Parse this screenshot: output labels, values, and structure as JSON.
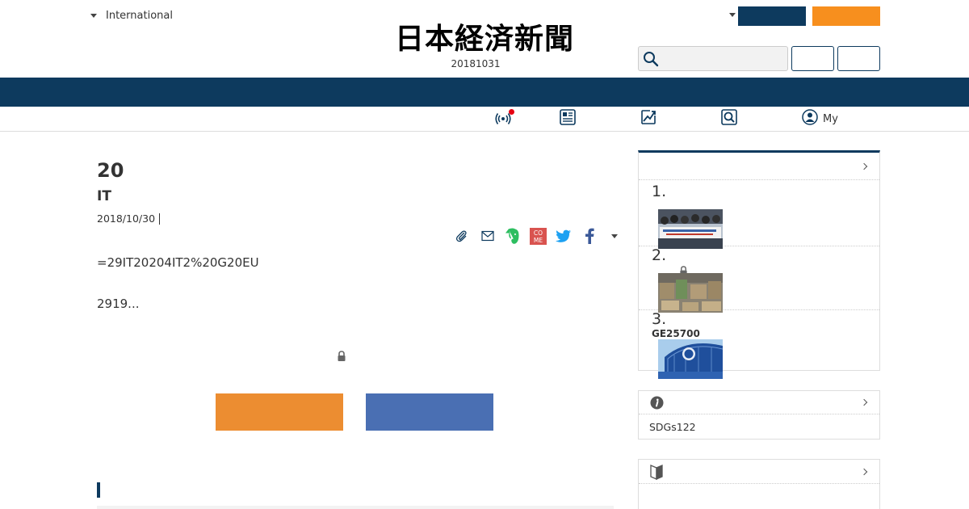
{
  "header": {
    "region_label": "International",
    "logo_text": "日本経済新聞",
    "date_code": "20181031",
    "login_label": "",
    "subscribe_label": "",
    "search_placeholder": "",
    "button1_label": "",
    "button2_label": ""
  },
  "subnav": {
    "my_label": "My"
  },
  "article": {
    "headline": "20",
    "subhead": "IT",
    "date": "2018/10/30",
    "body_line1": "=29IT20204IT2%20G20EU",
    "body_line2": "2919...",
    "cta_primary": "",
    "cta_secondary": ""
  },
  "share": {
    "icons": [
      "clip-icon",
      "mail-icon",
      "evernote-icon",
      "comment-icon",
      "twitter-icon",
      "facebook-icon",
      "more-caret-icon"
    ]
  },
  "sidebar": {
    "ranking_title": "",
    "ranking": [
      {
        "num": "1.",
        "title": ""
      },
      {
        "num": "2.",
        "title": ""
      },
      {
        "num": "3.",
        "title": "GE25700"
      }
    ],
    "info_title": "",
    "info_text": "SDGs122",
    "guide_title": ""
  },
  "colors": {
    "navy": "#0d3a5e",
    "orange": "#f78f1e",
    "cta_orange": "#ec8d31",
    "cta_blue": "#4a6fb3",
    "alert_red": "#e60012"
  }
}
